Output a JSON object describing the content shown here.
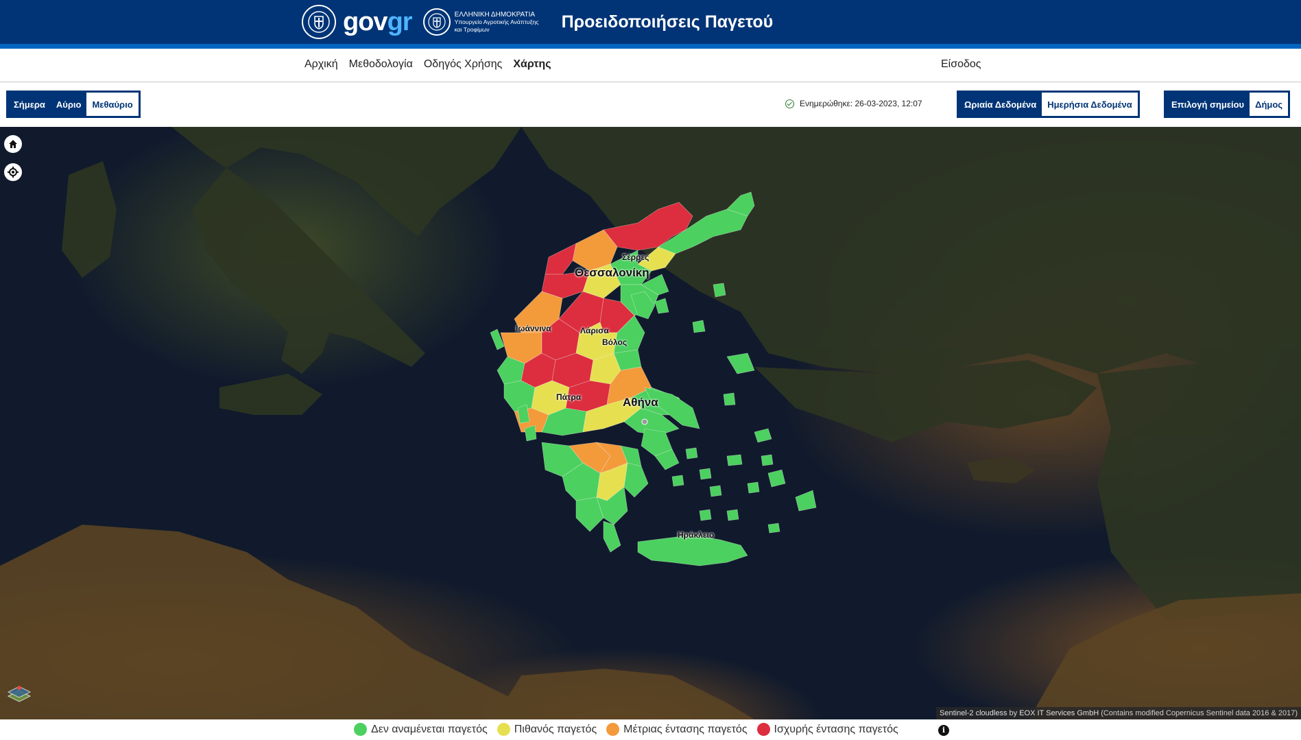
{
  "header": {
    "brand_text_gov": "gov",
    "brand_text_gr": "gr",
    "ministry_lines": [
      "ΕΛΛΗΝΙΚΗ ΔΗΜΟΚΡΑΤΙΑ",
      "Υπουργείο Αγροτικής Ανάπτυξης",
      "και Τροφίμων"
    ],
    "app_title": "Προειδοποιήσεις Παγετού"
  },
  "nav": {
    "links": [
      "Αρχική",
      "Μεθοδολογία",
      "Οδηγός Χρήσης",
      "Χάρτης"
    ],
    "active": "Χάρτης",
    "login": "Είσοδος"
  },
  "toolbar": {
    "day_options": [
      "Σήμερα",
      "Αύριο",
      "Μεθαύριο"
    ],
    "day_selected": "Μεθαύριο",
    "updated": "Ενημερώθηκε: 26-03-2023, 12:07",
    "data_options": [
      "Ωριαία Δεδομένα",
      "Ημερήσια Δεδομένα"
    ],
    "data_selected": "Ημερήσια Δεδομένα",
    "point_options": [
      "Επιλογή σημείου",
      "Δήμος"
    ],
    "point_selected": "Δήμος"
  },
  "map": {
    "cities": [
      "Σέρρες",
      "Θεσσαλονίκη",
      "Ιωάννινα",
      "Λάρισα",
      "Βόλος",
      "Πάτρα",
      "Αθήνα",
      "Ηράκλειο"
    ],
    "attribution_source": "Sentinel-2 cloudless",
    "attribution_by": "by",
    "attribution_provider": "EOX IT Services GmbH",
    "attribution_note": "(Contains modified Copernicus Sentinel data 2016 & 2017)"
  },
  "legend": {
    "items": [
      {
        "label": "Δεν αναμένεται παγετός",
        "color": "#4cd05f"
      },
      {
        "label": "Πιθανός παγετός",
        "color": "#e6e050"
      },
      {
        "label": "Μέτριας έντασης παγετός",
        "color": "#f39a3b"
      },
      {
        "label": "Ισχυρής έντασης παγετός",
        "color": "#dc2e3e"
      }
    ],
    "info_icon": "i"
  }
}
